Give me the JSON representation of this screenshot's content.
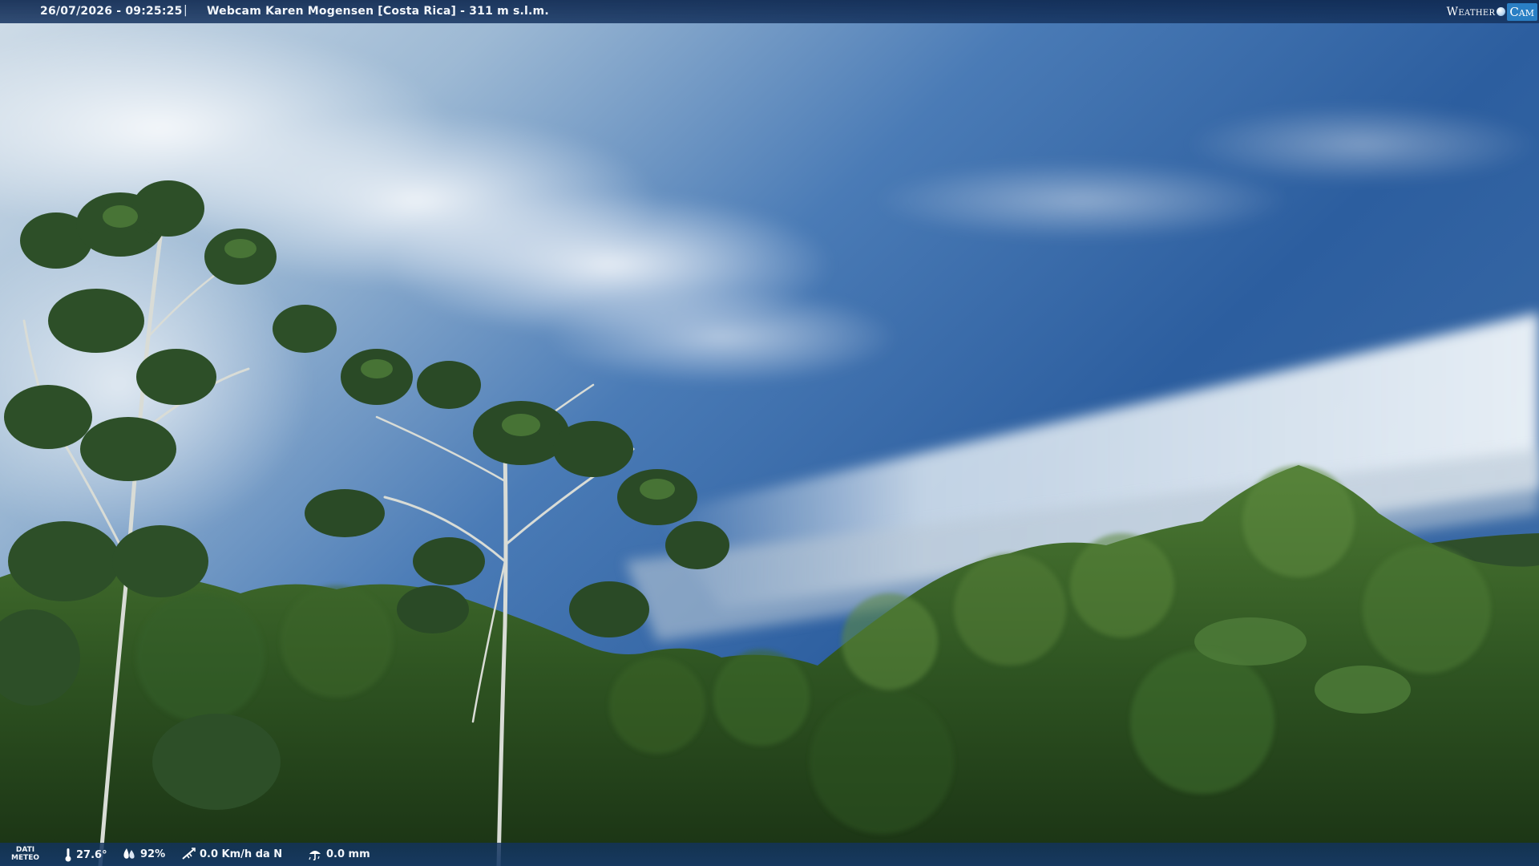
{
  "header": {
    "datetime": "26/07/2026 - 09:25:25",
    "separator": "|",
    "webcam_title": "Webcam Karen Mogensen [Costa Rica] - 311 m s.l.m."
  },
  "logo": {
    "text_weather": "Weather",
    "text_cam": "Cam"
  },
  "weather_bar": {
    "label_line1": "DATI",
    "label_line2": "METEO",
    "temperature": "27.6°",
    "humidity": "92%",
    "wind": "0.0 Km/h da N",
    "rain": "0.0 mm",
    "icons": [
      "thermometer-icon",
      "humidity-icon",
      "wind-icon",
      "rain-icon"
    ]
  },
  "colors": {
    "sky_top": "#c9d8e4",
    "sky_blue": "#2b5d9e",
    "foliage_dark": "#1f3a1a",
    "foliage_mid": "#3f6b2c",
    "bar_bg": "#163460",
    "logo_accent": "#2a7fc4"
  }
}
